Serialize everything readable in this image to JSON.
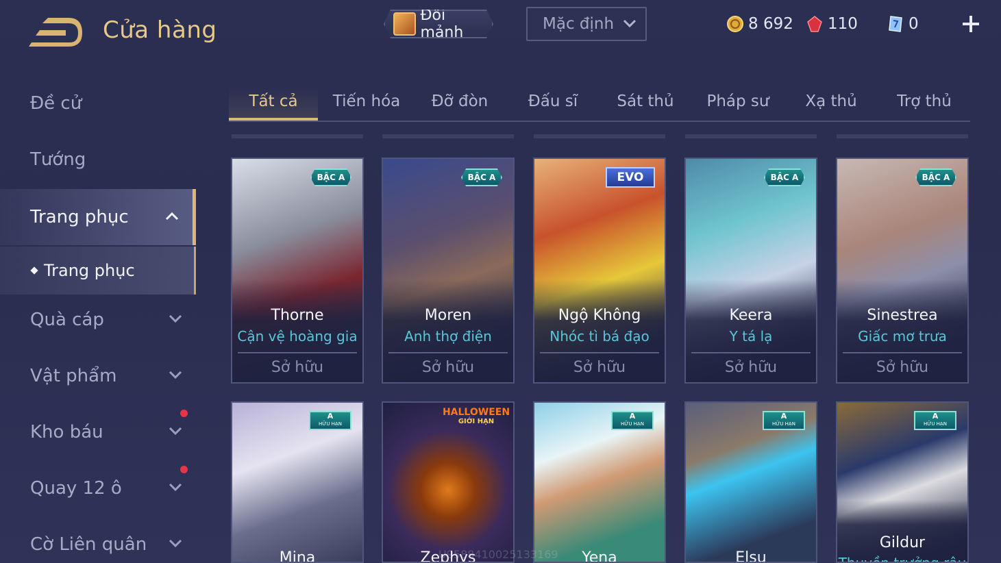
{
  "header": {
    "title": "Cửa hàng",
    "exchange_label": "Đổi mảnh",
    "sort_selected": "Mặc định",
    "currencies": [
      {
        "icon": "gold-coin-icon",
        "value": "8 692",
        "color": "#e0a93a"
      },
      {
        "icon": "red-gem-icon",
        "value": "110",
        "color": "#e0404f"
      },
      {
        "icon": "voucher-icon",
        "value": "0",
        "color": "#7fb6ff"
      }
    ]
  },
  "sidebar": {
    "items": [
      {
        "label": "Đề cử"
      },
      {
        "label": "Tướng"
      },
      {
        "label": "Trang phục"
      },
      {
        "label": "Quà cáp"
      },
      {
        "label": "Vật phẩm"
      },
      {
        "label": "Kho báu"
      },
      {
        "label": "Quay 12 ô"
      },
      {
        "label": "Cờ Liên quân"
      }
    ],
    "sub_item": "Trang phục"
  },
  "tabs": [
    "Tất cả",
    "Tiến hóa",
    "Đỡ đòn",
    "Đấu sĩ",
    "Sát thủ",
    "Pháp sư",
    "Xạ thủ",
    "Trợ thủ"
  ],
  "cards_row1": [
    {
      "hero": "Thorne",
      "skin": "Cận vệ hoàng gia",
      "status": "Sở hữu",
      "badge": "BẬC A"
    },
    {
      "hero": "Moren",
      "skin": "Anh thợ điện",
      "status": "Sở hữu",
      "badge": "BẬC A"
    },
    {
      "hero": "Ngộ Không",
      "skin": "Nhóc tì bá đạo",
      "status": "Sở hữu",
      "badge": "EVO"
    },
    {
      "hero": "Keera",
      "skin": "Y tá lạ",
      "status": "Sở hữu",
      "badge": "BẬC A"
    },
    {
      "hero": "Sinestrea",
      "skin": "Giấc mơ trưa",
      "status": "Sở hữu",
      "badge": "BẬC A"
    }
  ],
  "cards_row2": [
    {
      "hero": "Mina",
      "badge_grade": "A",
      "badge_sub": "HỮU HẠN"
    },
    {
      "hero": "Zephys",
      "badge_grade": "HALLOWEEN",
      "badge_sub": "GIỚI HẠN"
    },
    {
      "hero": "Yena",
      "badge_grade": "A",
      "badge_sub": "HỮU HẠN"
    },
    {
      "hero": "Elsu",
      "badge_grade": "A",
      "badge_sub": "HỮU HẠN"
    },
    {
      "hero": "Gildur",
      "skin": "Thuyền trưởng râu",
      "badge_grade": "A",
      "badge_sub": "HỮU HẠN"
    }
  ],
  "watermark": "U9588410025133169"
}
